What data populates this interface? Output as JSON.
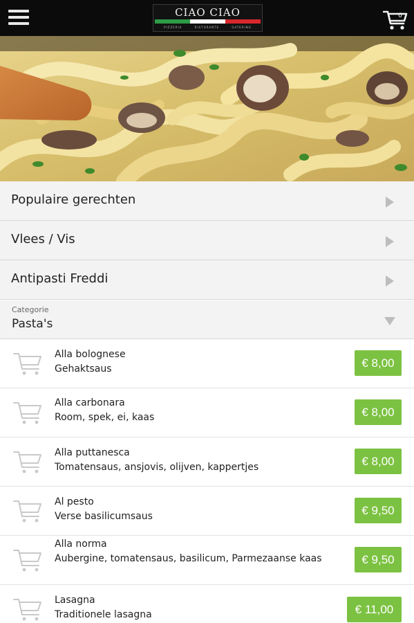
{
  "header": {
    "logo": {
      "name": "CIAO CIAO",
      "tagline": "PIZZERIA RISTORANTE GATERING"
    },
    "cart_count": "0"
  },
  "colors": {
    "header_bg": "#0b0b0b",
    "row_bg": "#f3f3f3",
    "price_bg": "#7cc242",
    "flag_green": "#2e9b46",
    "flag_white": "#ffffff",
    "flag_red": "#d8282d"
  },
  "categories": [
    {
      "label": "Populaire gerechten"
    },
    {
      "label": "Vlees / Vis"
    },
    {
      "label": "Antipasti Freddi"
    }
  ],
  "category_select": {
    "label": "Categorie",
    "value": "Pasta's"
  },
  "items": [
    {
      "name": "Alla bolognese",
      "desc": "Gehaktsaus",
      "price": "€ 8,00"
    },
    {
      "name": "Alla carbonara",
      "desc": "Room, spek, ei, kaas",
      "price": "€ 8,00"
    },
    {
      "name": "Alla puttanesca",
      "desc": "Tomatensaus, ansjovis, olijven, kappertjes",
      "price": "€ 8,00"
    },
    {
      "name": "Al pesto",
      "desc": "Verse basilicumsaus",
      "price": "€ 9,50"
    },
    {
      "name": "Alla norma",
      "desc": "Aubergine, tomatensaus, basilicum, Parmezaanse kaas",
      "price": "€ 9,50"
    },
    {
      "name": "Lasagna",
      "desc": "Traditionele lasagna",
      "price": "€ 11,00"
    }
  ],
  "icons": {
    "menu": "hamburger-menu-icon",
    "cart": "shopping-cart-icon",
    "expand": "triangle-right-icon",
    "dropdown": "triangle-down-icon"
  }
}
